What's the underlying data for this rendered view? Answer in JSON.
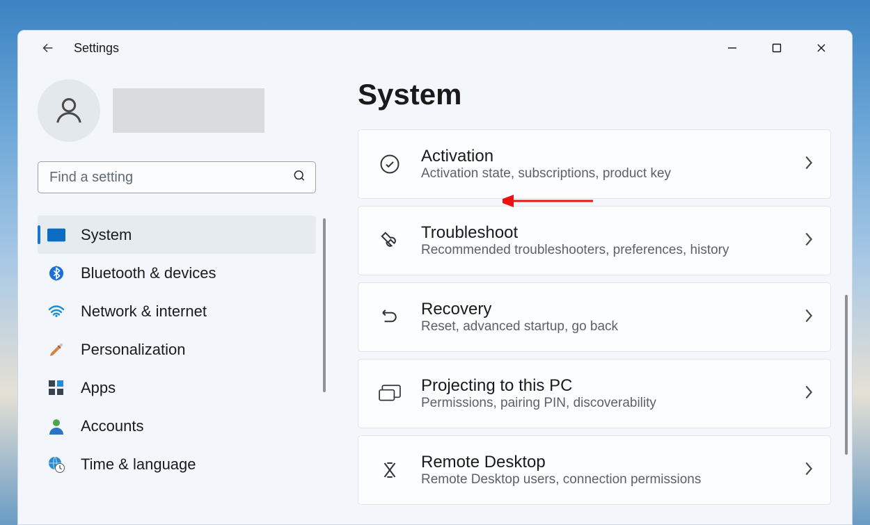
{
  "app_title": "Settings",
  "search": {
    "placeholder": "Find a setting"
  },
  "sidebar": {
    "items": [
      {
        "id": "system",
        "label": "System",
        "selected": true
      },
      {
        "id": "bluetooth",
        "label": "Bluetooth & devices",
        "selected": false
      },
      {
        "id": "network",
        "label": "Network & internet",
        "selected": false
      },
      {
        "id": "personalization",
        "label": "Personalization",
        "selected": false
      },
      {
        "id": "apps",
        "label": "Apps",
        "selected": false
      },
      {
        "id": "accounts",
        "label": "Accounts",
        "selected": false
      },
      {
        "id": "time",
        "label": "Time & language",
        "selected": false
      }
    ]
  },
  "main": {
    "title": "System",
    "cards": [
      {
        "id": "activation",
        "title": "Activation",
        "subtitle": "Activation state, subscriptions, product key"
      },
      {
        "id": "troubleshoot",
        "title": "Troubleshoot",
        "subtitle": "Recommended troubleshooters, preferences, history"
      },
      {
        "id": "recovery",
        "title": "Recovery",
        "subtitle": "Reset, advanced startup, go back"
      },
      {
        "id": "projecting",
        "title": "Projecting to this PC",
        "subtitle": "Permissions, pairing PIN, discoverability"
      },
      {
        "id": "remote",
        "title": "Remote Desktop",
        "subtitle": "Remote Desktop users, connection permissions"
      }
    ]
  }
}
